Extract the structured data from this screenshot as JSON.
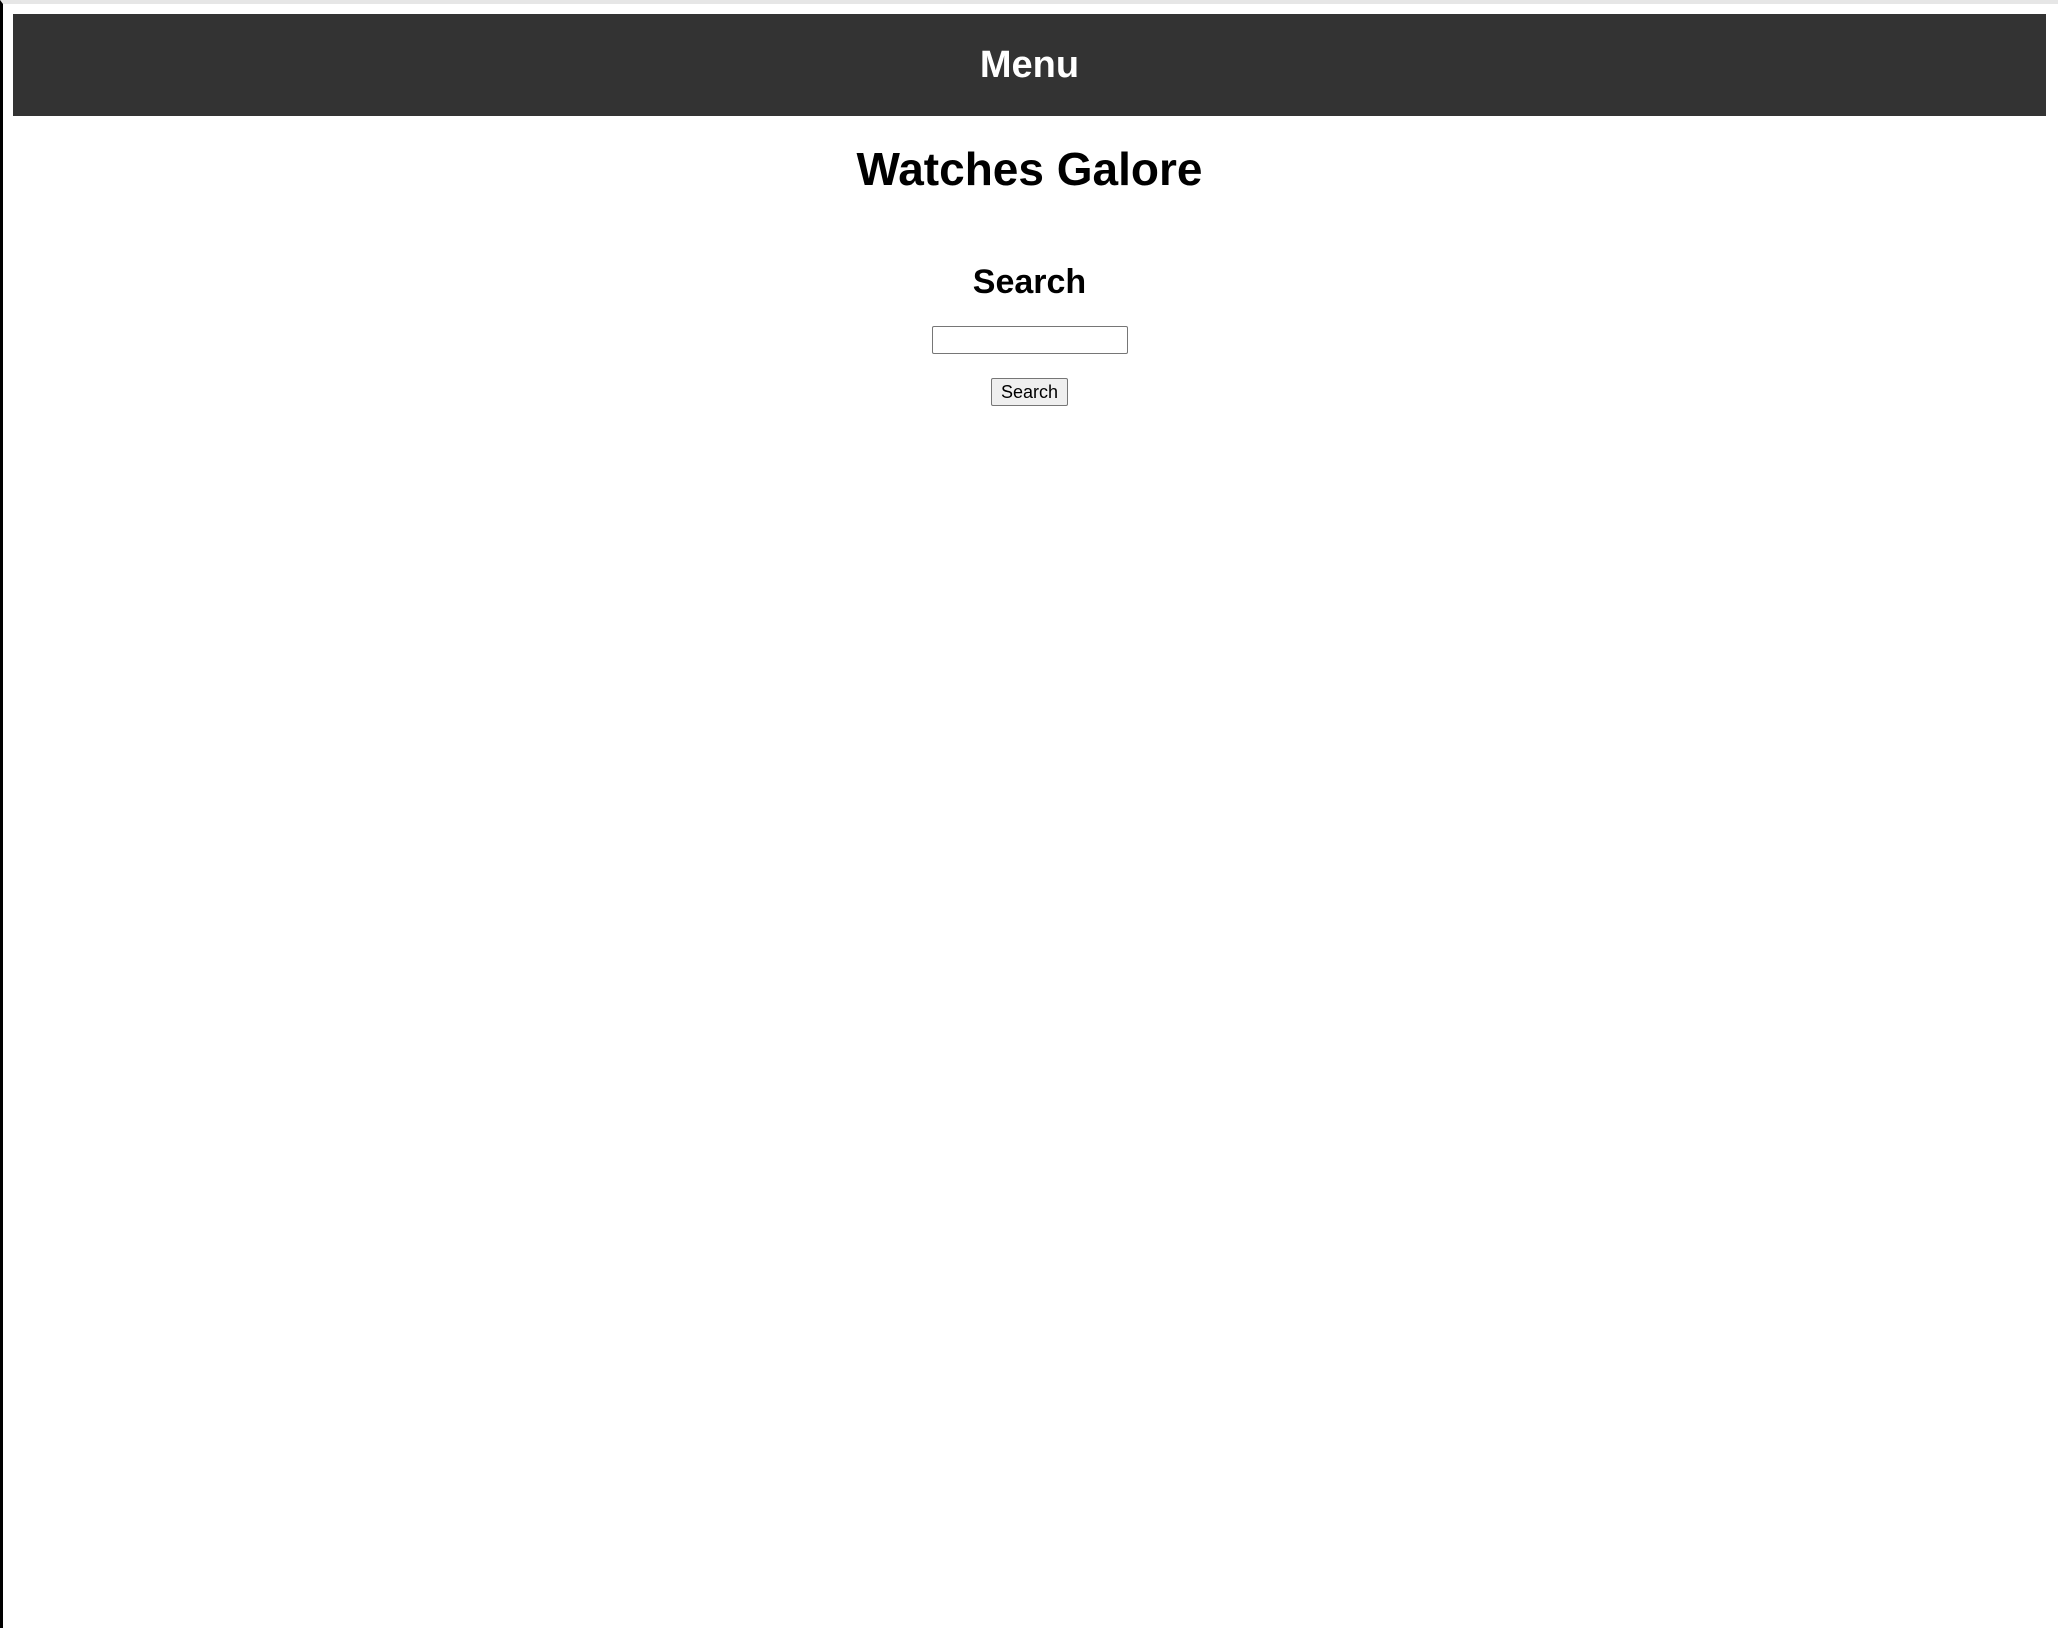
{
  "menu": {
    "title": "Menu"
  },
  "header": {
    "site_title": "Watches Galore"
  },
  "search": {
    "heading": "Search",
    "input_value": "",
    "placeholder": "",
    "button_label": "Search"
  },
  "colors": {
    "menu_background": "#333333",
    "menu_text": "#ffffff",
    "page_background": "#ffffff",
    "text": "#000000"
  }
}
